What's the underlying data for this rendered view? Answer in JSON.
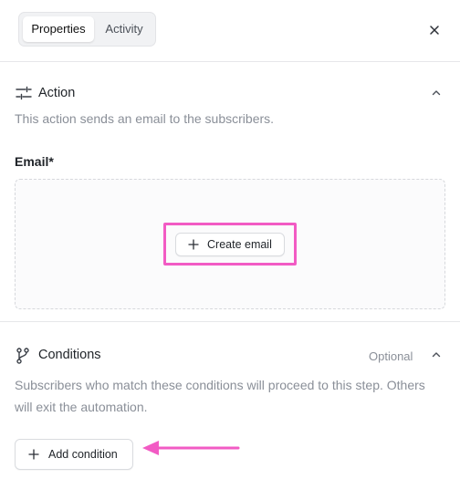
{
  "tabs": {
    "properties": "Properties",
    "activity": "Activity"
  },
  "action": {
    "title": "Action",
    "description": "This action sends an email to the subscribers.",
    "email_label": "Email*",
    "create_button": "Create email"
  },
  "conditions": {
    "title": "Conditions",
    "optional_label": "Optional",
    "description_line1": "Subscribers who match these conditions will proceed to this step. Others",
    "description_line2": "will exit the automation.",
    "add_button": "Add condition"
  },
  "colors": {
    "highlight": "#f25bc4",
    "arrow": "#f25bc4"
  },
  "icons": [
    "sliders-icon",
    "close-icon",
    "chevron-up-icon",
    "plus-icon",
    "git-branch-icon",
    "arrow-left-icon"
  ]
}
